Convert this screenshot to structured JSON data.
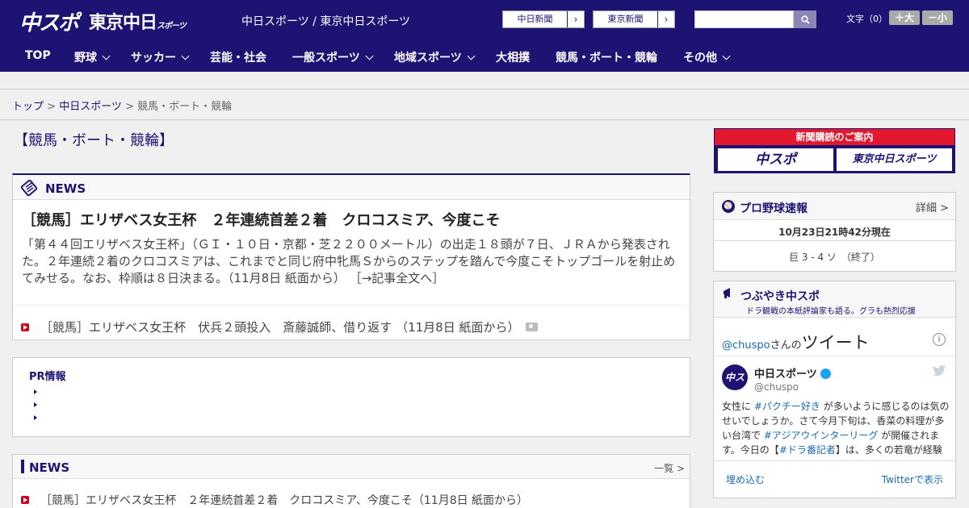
{
  "header": {
    "logo_chuspo": "中スポ",
    "logo_tokyo": "東京中日",
    "logo_tokyo_small": "スポーツ",
    "site_title": "中日スポーツ / 東京中日スポーツ",
    "paper_buttons": [
      "中日新聞",
      "東京新聞"
    ],
    "search_placeholder": "",
    "text_size_label": "文字（0）",
    "size_up_label": "＋大",
    "size_down_label": "－小"
  },
  "nav": {
    "items": [
      {
        "label": "TOP",
        "dropdown": false
      },
      {
        "label": "野球",
        "dropdown": true
      },
      {
        "label": "サッカー",
        "dropdown": true
      },
      {
        "label": "芸能・社会",
        "dropdown": false
      },
      {
        "label": "一般スポーツ",
        "dropdown": true
      },
      {
        "label": "地域スポーツ",
        "dropdown": true
      },
      {
        "label": "大相撲",
        "dropdown": false
      },
      {
        "label": "競馬・ボート・競輪",
        "dropdown": false
      },
      {
        "label": "その他",
        "dropdown": true
      }
    ]
  },
  "breadcrumb": {
    "top": "トップ",
    "sep": " > ",
    "chunichi": "中日スポーツ",
    "current": "競馬・ボート・競輪"
  },
  "page_title": "【競馬・ボート・競輪】",
  "news": {
    "heading": "NEWS",
    "main_headline": "［競馬］エリザベス女王杯　２年連続首差２着　クロコスミア、今度こそ",
    "main_body": "「第４４回エリザベス女王杯」（ＧＩ・１０日・京都・芝２２００メートル）の出走１８頭が７日、ＪＲＡから発表された。２年連続２着のクロコスミアは、これまでと同じ府中牝馬Ｓからのステップを踏んで今度こそトップゴールを射止めてみせる。なお、枠順は８日決まる。（11月8日 紙面から）",
    "read_more": "［→記事全文へ］",
    "sub_item": "［競馬］エリザベス女王杯　伏兵２頭投入　斎藤誠師、借り返す （11月8日 紙面から）"
  },
  "pr": {
    "heading": "PR情報",
    "items": [
      "",
      "",
      ""
    ]
  },
  "news_list": {
    "heading": "NEWS",
    "more": "一覧 >",
    "items": [
      "［競馬］エリザベス女王杯　２年連続首差２着　クロコスミア、今度こそ（11月8日 紙面から）"
    ]
  },
  "sidebar": {
    "subscription_banner": "新聞購読のご案内",
    "banner_logos": [
      "中スポ",
      "東京中日スポーツ"
    ],
    "baseball": {
      "title": "プロ野球速報",
      "detail": "詳細 >",
      "updated": "10月23日21時42分現在",
      "score": "巨 3 - 4 ソ　（終了）"
    },
    "twitter": {
      "title": "つぶやき中スポ",
      "subtitle": "ドラ観戦の本紙評論家も語る。グラも熱烈応援",
      "user_at": "@chuspo",
      "user_san": "さんの",
      "user_tweet": "ツイート",
      "account_name": "中日スポーツ",
      "account_handle": "@chuspo",
      "avatar_text": "中スポ",
      "tweet_text": "女性に #パクチー好き が多いように感じるのは気のせいでしょうか。さて今月下旬は、香菜の料理が多い台湾で #アジアウインターリーグ が開催されます。今日の【#ドラ番記者】は、多くの若竜が経験",
      "embed": "埋め込む",
      "view_on_twitter": "Twitterで表示"
    }
  },
  "colors": {
    "brand_navy": "#1c1373",
    "accent_red": "#e3172d",
    "link_blue": "#1b6bb0"
  }
}
